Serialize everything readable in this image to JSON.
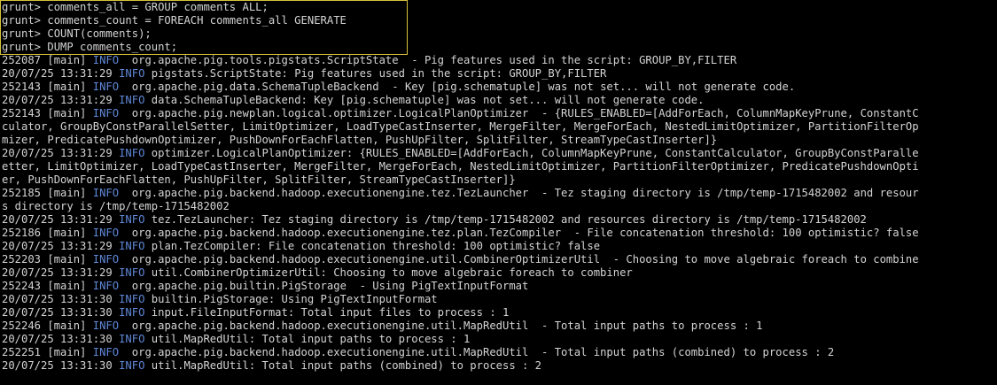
{
  "colors": {
    "background": "#000000",
    "text": "#d4d4d4",
    "info_level": "#5f87d7",
    "highlight_box": "#d8c33a"
  },
  "commands": [
    "grunt> comments_all = GROUP comments ALL;",
    "grunt> comments_count = FOREACH comments_all GENERATE",
    "grunt> COUNT(comments);",
    "grunt> DUMP comments_count;"
  ],
  "log": [
    {
      "prefix": "252087 [main] ",
      "level": "INFO",
      "msg": "  org.apache.pig.tools.pigstats.ScriptState  - Pig features used in the script: GROUP_BY,FILTER"
    },
    {
      "prefix": "20/07/25 13:31:29 ",
      "level": "INFO",
      "msg": " pigstats.ScriptState: Pig features used in the script: GROUP_BY,FILTER"
    },
    {
      "prefix": "252143 [main] ",
      "level": "INFO",
      "msg": "  org.apache.pig.data.SchemaTupleBackend  - Key [pig.schematuple] was not set... will not generate code."
    },
    {
      "prefix": "20/07/25 13:31:29 ",
      "level": "INFO",
      "msg": " data.SchemaTupleBackend: Key [pig.schematuple] was not set... will not generate code."
    },
    {
      "prefix": "252143 [main] ",
      "level": "INFO",
      "msg": "  org.apache.pig.newplan.logical.optimizer.LogicalPlanOptimizer  - {RULES_ENABLED=[AddForEach, ColumnMapKeyPrune, ConstantC"
    },
    {
      "prefix": "",
      "level": "",
      "msg": "culator, GroupByConstParallelSetter, LimitOptimizer, LoadTypeCastInserter, MergeFilter, MergeForEach, NestedLimitOptimizer, PartitionFilterOp"
    },
    {
      "prefix": "",
      "level": "",
      "msg": "mizer, PredicatePushdownOptimizer, PushDownForEachFlatten, PushUpFilter, SplitFilter, StreamTypeCastInserter]}"
    },
    {
      "prefix": "20/07/25 13:31:29 ",
      "level": "INFO",
      "msg": " optimizer.LogicalPlanOptimizer: {RULES_ENABLED=[AddForEach, ColumnMapKeyPrune, ConstantCalculator, GroupByConstParalle"
    },
    {
      "prefix": "",
      "level": "",
      "msg": "etter, LimitOptimizer, LoadTypeCastInserter, MergeFilter, MergeForEach, NestedLimitOptimizer, PartitionFilterOptimizer, PredicatePushdownOpti"
    },
    {
      "prefix": "",
      "level": "",
      "msg": "er, PushDownForEachFlatten, PushUpFilter, SplitFilter, StreamTypeCastInserter]}"
    },
    {
      "prefix": "252185 [main] ",
      "level": "INFO",
      "msg": "  org.apache.pig.backend.hadoop.executionengine.tez.TezLauncher  - Tez staging directory is /tmp/temp-1715482002 and resour"
    },
    {
      "prefix": "",
      "level": "",
      "msg": "s directory is /tmp/temp-1715482002"
    },
    {
      "prefix": "20/07/25 13:31:29 ",
      "level": "INFO",
      "msg": " tez.TezLauncher: Tez staging directory is /tmp/temp-1715482002 and resources directory is /tmp/temp-1715482002"
    },
    {
      "prefix": "252186 [main] ",
      "level": "INFO",
      "msg": "  org.apache.pig.backend.hadoop.executionengine.tez.plan.TezCompiler  - File concatenation threshold: 100 optimistic? false"
    },
    {
      "prefix": "20/07/25 13:31:29 ",
      "level": "INFO",
      "msg": " plan.TezCompiler: File concatenation threshold: 100 optimistic? false"
    },
    {
      "prefix": "252203 [main] ",
      "level": "INFO",
      "msg": "  org.apache.pig.backend.hadoop.executionengine.util.CombinerOptimizerUtil  - Choosing to move algebraic foreach to combine"
    },
    {
      "prefix": "20/07/25 13:31:29 ",
      "level": "INFO",
      "msg": " util.CombinerOptimizerUtil: Choosing to move algebraic foreach to combiner"
    },
    {
      "prefix": "252243 [main] ",
      "level": "INFO",
      "msg": "  org.apache.pig.builtin.PigStorage  - Using PigTextInputFormat"
    },
    {
      "prefix": "20/07/25 13:31:30 ",
      "level": "INFO",
      "msg": " builtin.PigStorage: Using PigTextInputFormat"
    },
    {
      "prefix": "20/07/25 13:31:30 ",
      "level": "INFO",
      "msg": " input.FileInputFormat: Total input files to process : 1"
    },
    {
      "prefix": "252246 [main] ",
      "level": "INFO",
      "msg": "  org.apache.pig.backend.hadoop.executionengine.util.MapRedUtil  - Total input paths to process : 1"
    },
    {
      "prefix": "20/07/25 13:31:30 ",
      "level": "INFO",
      "msg": " util.MapRedUtil: Total input paths to process : 1"
    },
    {
      "prefix": "252251 [main] ",
      "level": "INFO",
      "msg": "  org.apache.pig.backend.hadoop.executionengine.util.MapRedUtil  - Total input paths (combined) to process : 2"
    },
    {
      "prefix": "20/07/25 13:31:30 ",
      "level": "INFO",
      "msg": " util.MapRedUtil: Total input paths (combined) to process : 2"
    }
  ]
}
